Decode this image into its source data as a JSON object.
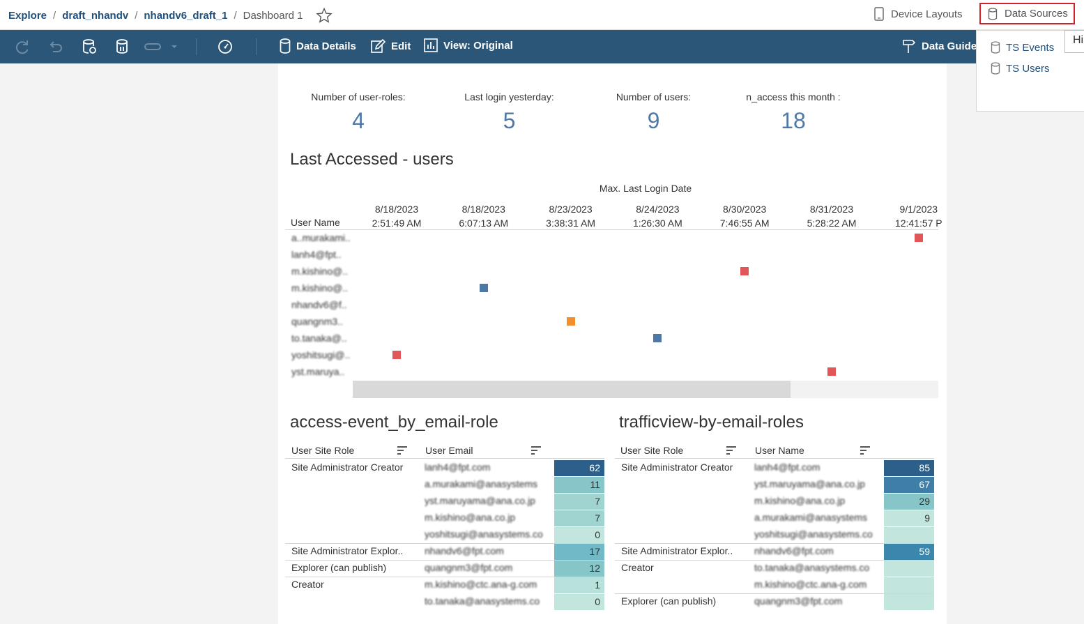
{
  "breadcrumb": {
    "items": [
      "Explore",
      "draft_nhandv",
      "nhandv6_draft_1"
    ],
    "current": "Dashboard 1",
    "separator": "/"
  },
  "header": {
    "device_layouts": "Device Layouts",
    "data_sources": "Data Sources"
  },
  "toolbar": {
    "data_details": "Data Details",
    "edit": "Edit",
    "view": "View: Original",
    "data_guide": "Data Guide"
  },
  "data_sources_menu": {
    "items": [
      "TS Events",
      "TS Users"
    ],
    "tooltip": "Hi"
  },
  "kpis": [
    {
      "label": "Number of user-roles:",
      "value": "4"
    },
    {
      "label": "Last login yesterday:",
      "value": "5"
    },
    {
      "label": "Number of users:",
      "value": "9"
    },
    {
      "label": "n_access this month :",
      "value": "18"
    }
  ],
  "last_accessed": {
    "title": "Last Accessed - users",
    "column_title": "Max. Last Login Date",
    "row_header": "User Name",
    "columns": [
      {
        "date": "8/18/2023",
        "time": "2:51:49 AM"
      },
      {
        "date": "8/18/2023",
        "time": "6:07:13 AM"
      },
      {
        "date": "8/23/2023",
        "time": "3:38:31 AM"
      },
      {
        "date": "8/24/2023",
        "time": "1:26:30 AM"
      },
      {
        "date": "8/30/2023",
        "time": "7:46:55 AM"
      },
      {
        "date": "8/31/2023",
        "time": "5:28:22 AM"
      },
      {
        "date": "9/1/2023",
        "time": "12:41:57 P"
      }
    ],
    "users": [
      "a..murakami..",
      "lanh4@fpt..",
      "m.kishino@..",
      "m.kishino@..",
      "nhandv6@f..",
      "quangnm3..",
      "to.tanaka@..",
      "yoshitsugi@..",
      "yst.maruya.."
    ],
    "marks": [
      {
        "row": 0,
        "col": 6,
        "color": "#e15759"
      },
      {
        "row": 2,
        "col": 4,
        "color": "#e15759"
      },
      {
        "row": 3,
        "col": 1,
        "color": "#4e79a7"
      },
      {
        "row": 5,
        "col": 2,
        "color": "#f28e2b"
      },
      {
        "row": 6,
        "col": 3,
        "color": "#4e79a7"
      },
      {
        "row": 7,
        "col": 0,
        "color": "#e15759"
      },
      {
        "row": 8,
        "col": 5,
        "color": "#e15759"
      }
    ]
  },
  "access_event": {
    "title": "access-event_by_email-role",
    "col_role": "User Site Role",
    "col_email": "User Email",
    "groups": [
      {
        "role": "Site Administrator Creator",
        "rows": [
          {
            "email": "lanh4@fpt.com",
            "value": "62",
            "color": "#2c5f8a",
            "text": "#fff"
          },
          {
            "email": "a.murakami@anasystems",
            "value": "11",
            "color": "#86c6c8",
            "text": "#333"
          },
          {
            "email": "yst.maruyama@ana.co.jp",
            "value": "7",
            "color": "#9fd4d0",
            "text": "#333"
          },
          {
            "email": "m.kishino@ana.co.jp",
            "value": "7",
            "color": "#9fd4d0",
            "text": "#333"
          },
          {
            "email": "yoshitsugi@anasystems.co",
            "value": "0",
            "color": "#c2e6de",
            "text": "#333"
          }
        ]
      },
      {
        "role": "Site Administrator Explor..",
        "rows": [
          {
            "email": "nhandv6@fpt.com",
            "value": "17",
            "color": "#72b9c7",
            "text": "#333"
          }
        ]
      },
      {
        "role": "Explorer (can publish)",
        "rows": [
          {
            "email": "quangnm3@fpt.com",
            "value": "12",
            "color": "#86c6c8",
            "text": "#333"
          }
        ]
      },
      {
        "role": "Creator",
        "rows": [
          {
            "email": "m.kishino@ctc.ana-g.com",
            "value": "1",
            "color": "#b8e1db",
            "text": "#333"
          },
          {
            "email": "to.tanaka@anasystems.co",
            "value": "0",
            "color": "#c2e6de",
            "text": "#333"
          }
        ]
      }
    ]
  },
  "trafficview": {
    "title": "trafficview-by-email-roles",
    "col_role": "User Site Role",
    "col_name": "User Name",
    "groups": [
      {
        "role": "Site Administrator Creator",
        "rows": [
          {
            "name": "lanh4@fpt.com",
            "value": "85",
            "color": "#2c5f8a",
            "text": "#fff"
          },
          {
            "name": "yst.maruyama@ana.co.jp",
            "value": "67",
            "color": "#3f7ea6",
            "text": "#fff"
          },
          {
            "name": "m.kishino@ana.co.jp",
            "value": "29",
            "color": "#86c6c8",
            "text": "#333"
          },
          {
            "name": "a.murakami@anasystems",
            "value": "9",
            "color": "#c2e6de",
            "text": "#333"
          },
          {
            "name": "yoshitsugi@anasystems.co",
            "value": "",
            "color": "#c2e6de",
            "text": "#333"
          }
        ]
      },
      {
        "role": "Site Administrator Explor..",
        "rows": [
          {
            "name": "nhandv6@fpt.com",
            "value": "59",
            "color": "#3a86ad",
            "text": "#fff"
          }
        ]
      },
      {
        "role": "Creator",
        "rows": [
          {
            "name": "to.tanaka@anasystems.co",
            "value": "",
            "color": "#c2e6de",
            "text": "#333"
          },
          {
            "name": "m.kishino@ctc.ana-g.com",
            "value": "",
            "color": "#c2e6de",
            "text": "#333"
          }
        ]
      },
      {
        "role": "Explorer (can publish)",
        "rows": [
          {
            "name": "quangnm3@fpt.com",
            "value": "",
            "color": "#c2e6de",
            "text": "#333"
          }
        ]
      }
    ]
  }
}
